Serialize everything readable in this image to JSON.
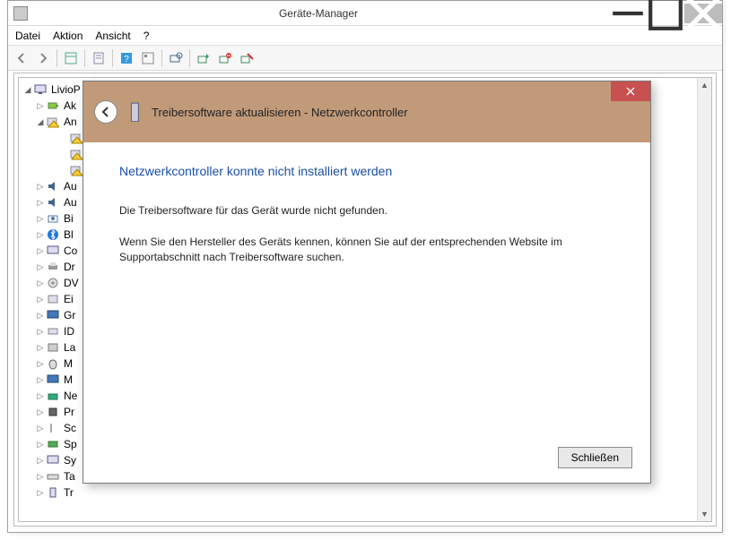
{
  "window": {
    "title": "Geräte-Manager"
  },
  "menu": {
    "file": "Datei",
    "action": "Aktion",
    "view": "Ansicht",
    "help": "?"
  },
  "tree": {
    "root": "LivioP",
    "items": [
      "Ak",
      "An",
      "Au",
      "Au",
      "Bi",
      "Bl",
      "Co",
      "Dr",
      "DV",
      "Ei",
      "Gr",
      "ID",
      "La",
      "M",
      "M",
      "Ne",
      "Pr",
      "Sc",
      "Sp",
      "Sy",
      "Ta",
      "Tr"
    ]
  },
  "dialog": {
    "title": "Treibersoftware aktualisieren - Netzwerkcontroller",
    "heading": "Netzwerkcontroller konnte nicht installiert werden",
    "msg1": "Die Treibersoftware für das Gerät wurde nicht gefunden.",
    "msg2": "Wenn Sie den Hersteller des Geräts kennen, können Sie auf der entsprechenden Website im Supportabschnitt nach Treibersoftware suchen.",
    "close_btn": "Schließen"
  }
}
